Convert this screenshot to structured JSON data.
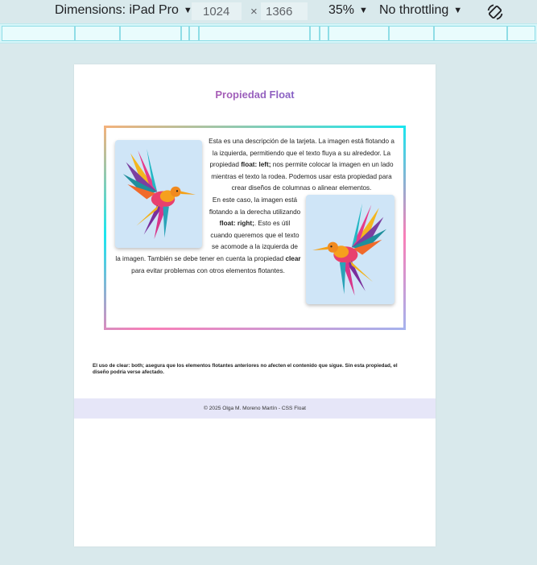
{
  "devtools": {
    "dimensions_label": "Dimensions: iPad Pro",
    "width": "1024",
    "times": "×",
    "height": "1366",
    "zoom": "35%",
    "throttling": "No throttling",
    "icons": [
      "caret-down-icon",
      "rotate-icon"
    ]
  },
  "page": {
    "title": "Propiedad Float",
    "card": {
      "para1": [
        {
          "text": "Esta es una descripción de la tarjeta. La imagen está flotando a la izquierda, permitiendo que el texto fluya a su alrededor. La propiedad "
        },
        {
          "text": "float: left;",
          "bold": true
        },
        {
          "text": " nos permite colocar la imagen en un lado mientras el texto la rodea. Podemos usar esta propiedad para crear diseños de columnas o alinear elementos."
        }
      ],
      "para2": [
        {
          "text": "En este caso, la imagen está flotando a la derecha utilizando "
        },
        {
          "text": "float: right;",
          "bold": true
        },
        {
          "text": ". Esto es útil cuando queremos que el texto se acomode a la izquierda de la imagen. También se debe tener en cuenta la propiedad "
        },
        {
          "text": "clear",
          "bold": true
        },
        {
          "text": " para evitar problemas con otros elementos flotantes."
        }
      ]
    },
    "note": "El uso de clear: both; asegura que los elementos flotantes anteriores no afecten el contenido que sigue. Sin esta propiedad, el diseño podría verse afectado.",
    "footer": "© 2025 Olga M. Moreno Martín - CSS Float"
  }
}
